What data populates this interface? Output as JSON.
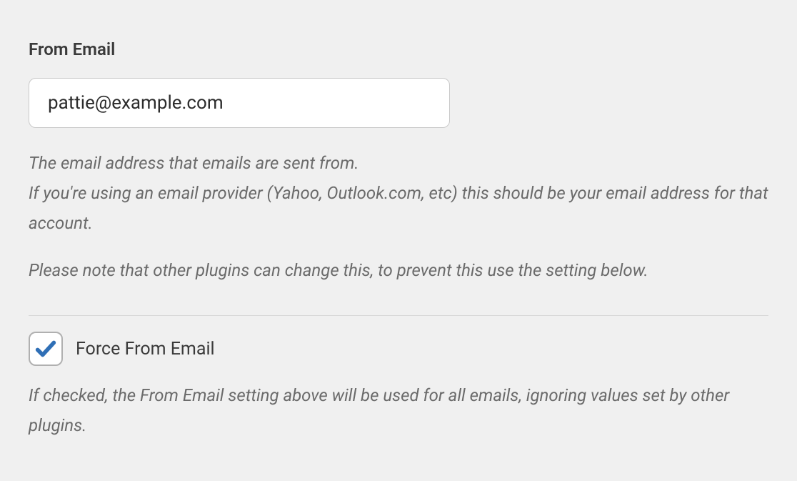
{
  "from_email": {
    "heading": "From Email",
    "value": "pattie@example.com",
    "desc_line1": "The email address that emails are sent from.",
    "desc_line2": "If you're using an email provider (Yahoo, Outlook.com, etc) this should be your email address for that account.",
    "desc_line3": "Please note that other plugins can change this, to prevent this use the setting below."
  },
  "force_from_email": {
    "label": "Force From Email",
    "checked": true,
    "description": "If checked, the From Email setting above will be used for all emails, ignoring values set by other plugins."
  }
}
